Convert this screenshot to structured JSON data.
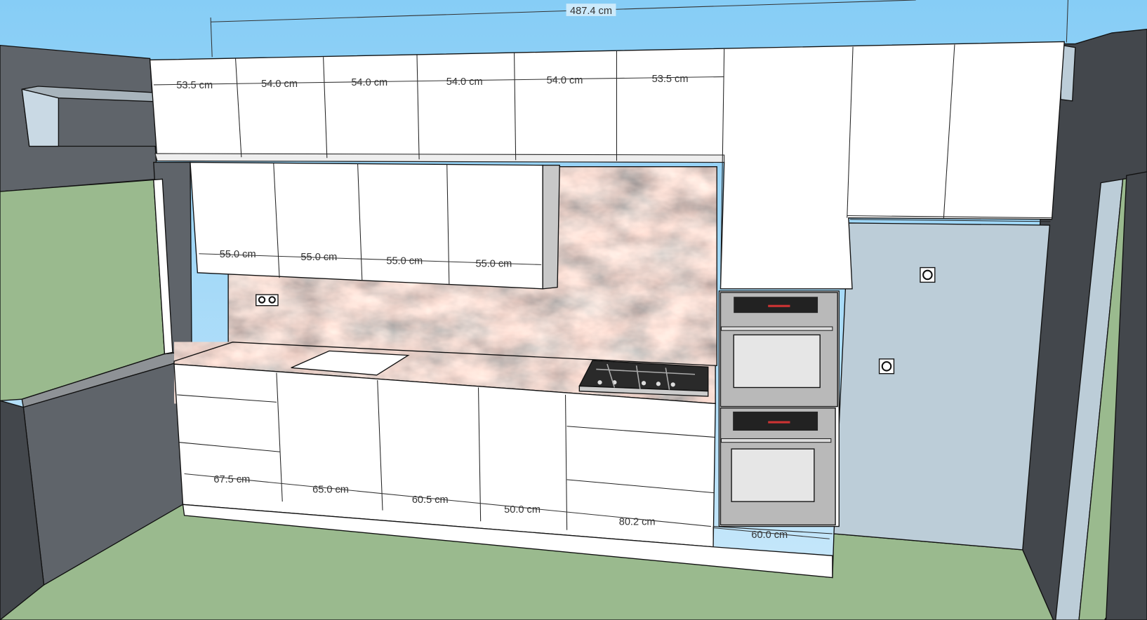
{
  "scene": {
    "colors": {
      "sky_top": "#86cdf6",
      "sky_bottom": "#cbe9fb",
      "wall_dark": "#5f646a",
      "wall_darker": "#43474c",
      "floor": "#9aba8e",
      "wall_light": "#bccdd8",
      "cabinet": "#ffffff",
      "granite": "#8a8585"
    },
    "dimensions": {
      "overall": "487.4 cm",
      "upper_row": [
        "53.5 cm",
        "54.0 cm",
        "54.0 cm",
        "54.0 cm",
        "54.0 cm",
        "53.5 cm"
      ],
      "wall_cabinets": [
        "55.0 cm",
        "55.0 cm",
        "55.0 cm",
        "55.0 cm"
      ],
      "base_cabinets": [
        "67.5 cm",
        "65.0 cm",
        "60.5 cm",
        "50.0 cm",
        "80.2 cm",
        "60.0 cm"
      ]
    }
  }
}
